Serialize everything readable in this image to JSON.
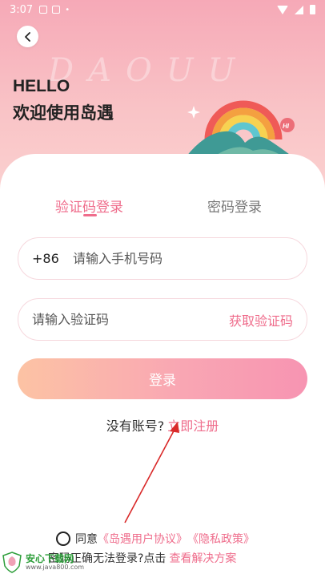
{
  "status_bar": {
    "time": "3:07"
  },
  "header": {
    "watermark": "DAOUU",
    "hello": "HELLO",
    "welcome": "欢迎使用岛遇"
  },
  "tabs": [
    {
      "label": "验证码登录",
      "active": true
    },
    {
      "label": "密码登录",
      "active": false
    }
  ],
  "phone_field": {
    "country_code": "+86",
    "placeholder": "请输入手机号码",
    "value": ""
  },
  "code_field": {
    "placeholder": "请输入验证码",
    "value": "",
    "action_label": "获取验证码"
  },
  "login_button": {
    "label": "登录"
  },
  "register": {
    "prompt": "没有账号?",
    "link_label": "立即注册"
  },
  "agreement": {
    "prefix": "同意",
    "user_agreement": "《岛遇用户协议》",
    "privacy_policy": "《隐私政策》"
  },
  "help": {
    "text": "密码正确无法登录?点击",
    "link_label": "查看解决方案"
  },
  "site_watermark": {
    "brand": "安心下载网",
    "url": "www.java800.com"
  },
  "colors": {
    "accent": "#ef6d8c",
    "button_gradient_start": "#fcc3a4",
    "button_gradient_end": "#f794b2"
  }
}
